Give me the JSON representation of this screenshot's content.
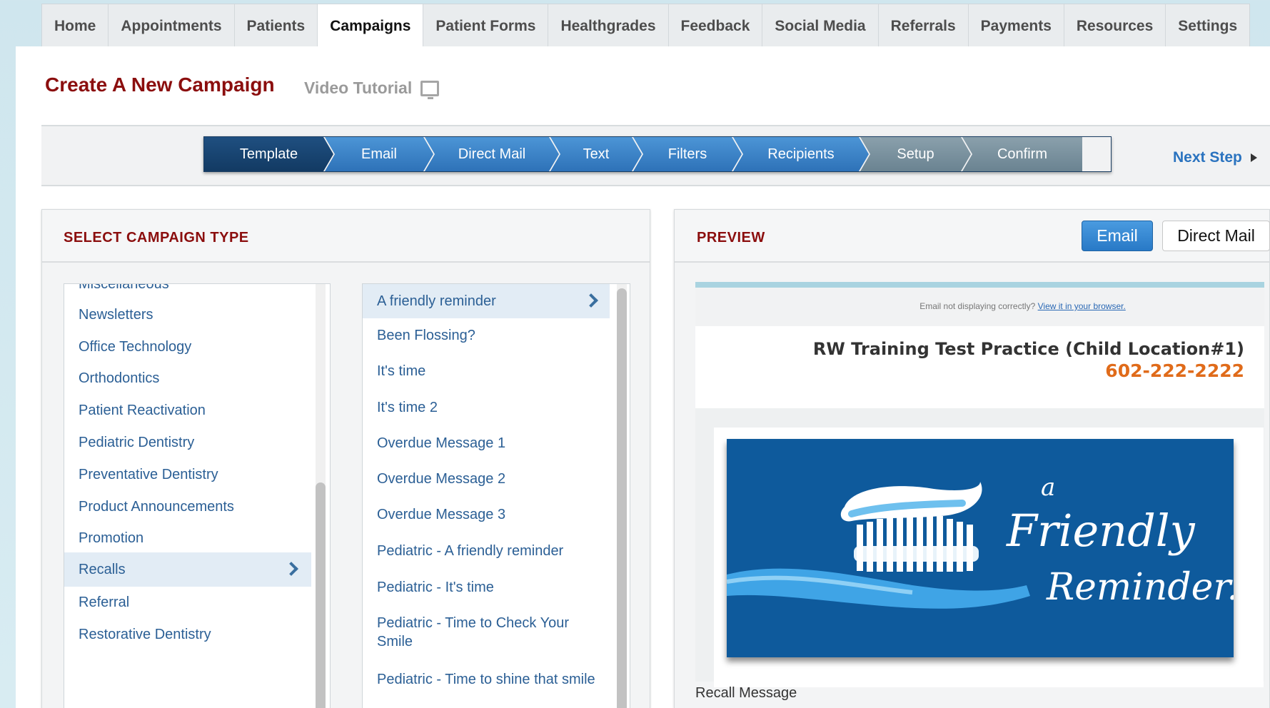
{
  "nav": {
    "tabs": [
      {
        "label": "Home"
      },
      {
        "label": "Appointments"
      },
      {
        "label": "Patients"
      },
      {
        "label": "Campaigns"
      },
      {
        "label": "Patient Forms"
      },
      {
        "label": "Healthgrades"
      },
      {
        "label": "Feedback"
      },
      {
        "label": "Social Media"
      },
      {
        "label": "Referrals"
      },
      {
        "label": "Payments"
      },
      {
        "label": "Resources"
      },
      {
        "label": "Settings"
      }
    ],
    "active": "Campaigns"
  },
  "page": {
    "title": "Create A New Campaign",
    "video_tutorial": "Video Tutorial"
  },
  "wizard": {
    "steps": [
      "Template",
      "Email",
      "Direct Mail",
      "Text",
      "Filters",
      "Recipients",
      "Setup",
      "Confirm"
    ],
    "current": "Template",
    "next_label": "Next Step"
  },
  "campaign_type": {
    "heading": "SELECT CAMPAIGN TYPE",
    "categories": [
      "Miscellaneous",
      "Newsletters",
      "Office Technology",
      "Orthodontics",
      "Patient Reactivation",
      "Pediatric Dentistry",
      "Preventative Dentistry",
      "Product Announcements",
      "Promotion",
      "Recalls",
      "Referral",
      "Restorative Dentistry"
    ],
    "selected_category": "Recalls",
    "templates": [
      "A friendly reminder",
      "Been Flossing?",
      "It's time",
      "It's time 2",
      "Overdue Message 1",
      "Overdue Message 2",
      "Overdue Message 3",
      "Pediatric - A friendly reminder",
      "Pediatric - It's time",
      "Pediatric - Time to Check Your Smile",
      "Pediatric - Time to shine that smile"
    ],
    "selected_template": "A friendly reminder"
  },
  "preview": {
    "heading": "PREVIEW",
    "email_button": "Email",
    "direct_mail_button": "Direct Mail",
    "notice_text": "Email not displaying correctly?",
    "notice_link": "View it in your browser.",
    "practice_name": "RW Training Test Practice (Child Location#1)",
    "practice_phone": "602-222-2222",
    "banner_line1": "a",
    "banner_line2": "Friendly",
    "banner_line3": "Reminder....",
    "caption": "Recall Message"
  },
  "colors": {
    "title_red": "#8b0e0e",
    "link_blue": "#2b5f95",
    "step_blue": "#2e72b8",
    "step_current": "#123a63",
    "phone_orange": "#e06b1a",
    "banner_blue": "#0e5a9c"
  }
}
